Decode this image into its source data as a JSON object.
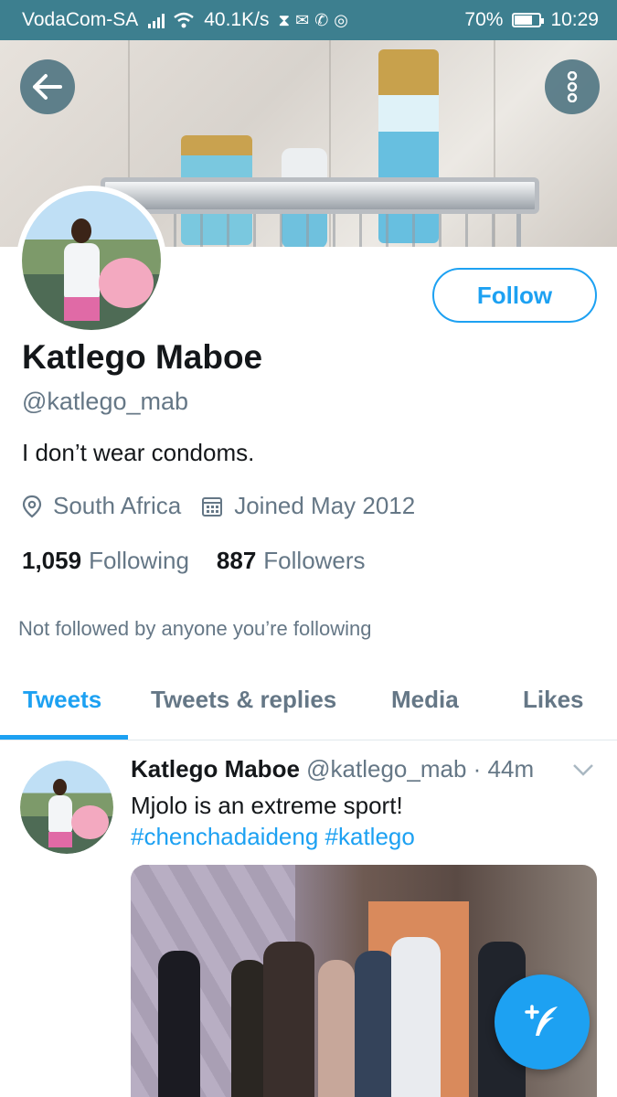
{
  "status_bar": {
    "carrier": "VodaCom-SA",
    "speed": "40.1K/s",
    "battery_percent": "70%",
    "battery_level": 0.7,
    "time": "10:29"
  },
  "profile": {
    "display_name": "Katlego Maboe",
    "handle": "@katlego_mab",
    "bio": "I don’t wear condoms.",
    "location": "South Africa",
    "joined": "Joined May 2012",
    "following_count": "1,059",
    "following_label": "Following",
    "followers_count": "887",
    "followers_label": "Followers",
    "follow_button": "Follow",
    "social_context": "Not followed by anyone you’re following"
  },
  "tabs": [
    {
      "label": "Tweets",
      "active": true
    },
    {
      "label": "Tweets & replies",
      "active": false
    },
    {
      "label": "Media",
      "active": false
    },
    {
      "label": "Likes",
      "active": false
    }
  ],
  "tweet": {
    "name": "Katlego Maboe",
    "handle_time": "@katlego_mab · 44m",
    "text": "Mjolo is an extreme sport!",
    "hashtags": "#chenchadaideng #katlego"
  },
  "colors": {
    "accent": "#1da1f2",
    "status_bar": "#3d7f8f",
    "secondary_text": "#657786"
  },
  "icons": [
    "back-arrow-icon",
    "more-options-icon",
    "location-pin-icon",
    "calendar-icon",
    "chevron-down-icon",
    "compose-tweet-icon"
  ]
}
